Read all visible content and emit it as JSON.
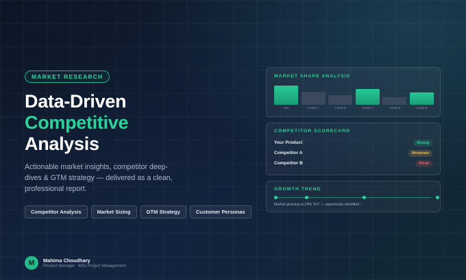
{
  "hero": {
    "tag": "MARKET RESEARCH",
    "title_line1": "Data-Driven",
    "title_line2": "Competitive",
    "title_line3": "Analysis",
    "description": "Actionable market insights, competitor deep-dives & GTM strategy — delivered as a clean, professional report.",
    "chips": [
      "Competitor Analysis",
      "Market Sizing",
      "GTM Strategy",
      "Customer Personas"
    ]
  },
  "author": {
    "initial": "M",
    "name": "Mahima Choudhary",
    "role": "Product Manager · MSc Project Management"
  },
  "market_share": {
    "title": "MARKET SHARE ANALYSIS",
    "chart_data": {
      "type": "bar",
      "categories": [
        "You",
        "Comp A",
        "Comp B",
        "Comp C",
        "Comp D",
        "Comp E"
      ],
      "values": [
        26,
        18,
        13,
        21,
        10,
        17
      ],
      "highlight": [
        true,
        false,
        false,
        true,
        false,
        true
      ],
      "colors": {
        "highlight": "#22b98a",
        "muted": "#3a4a5c"
      }
    }
  },
  "scorecard": {
    "title": "COMPETITOR SCORECARD",
    "rows": [
      {
        "name": "Your Product",
        "rating": "Strong",
        "color": "#2fd39c",
        "bg": "rgba(47,211,156,0.16)"
      },
      {
        "name": "Competitor A",
        "rating": "Moderate",
        "color": "#f2b84b",
        "bg": "rgba(242,184,75,0.18)"
      },
      {
        "name": "Competitor B",
        "rating": "Weak",
        "color": "#ef5a5a",
        "bg": "rgba(239,90,90,0.18)"
      }
    ]
  },
  "growth": {
    "title": "GROWTH TREND",
    "text": "Market growing at 24% YoY — opportunity identified ↑"
  }
}
